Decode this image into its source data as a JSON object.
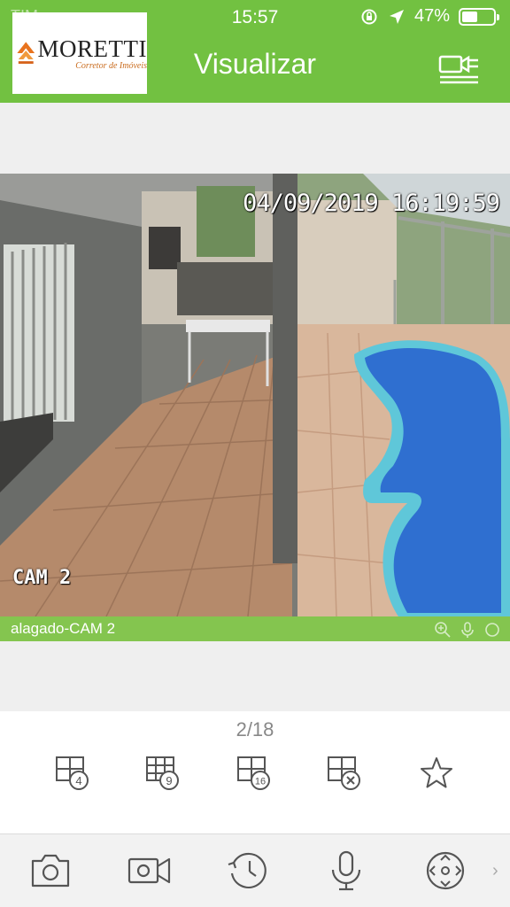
{
  "status_bar": {
    "carrier": "TIM",
    "time": "15:57",
    "battery": "47%"
  },
  "header": {
    "title": "Visualizar"
  },
  "logo": {
    "name": "MORETTI",
    "tagline": "Corretor de Imóveis"
  },
  "video": {
    "timestamp": "04/09/2019 16:19:59",
    "cam_label": "CAM 2",
    "caption": "alagado-CAM 2"
  },
  "pager": {
    "text": "2/18"
  },
  "layouts": [
    {
      "icon": "grid-4-icon",
      "badge": "4"
    },
    {
      "icon": "grid-9-icon",
      "badge": "9"
    },
    {
      "icon": "grid-16-icon",
      "badge": "16"
    },
    {
      "icon": "grid-close-icon"
    },
    {
      "icon": "star-icon"
    }
  ],
  "toolbar": [
    "camera-icon",
    "video-record-icon",
    "playback-icon",
    "microphone-icon",
    "ptz-icon"
  ],
  "colors": {
    "brand_green": "#72c141",
    "caption_green": "#84c54f",
    "pool_blue": "#2f6fd0",
    "icon_gray": "#555555",
    "logo_orange": "#e8731e"
  }
}
